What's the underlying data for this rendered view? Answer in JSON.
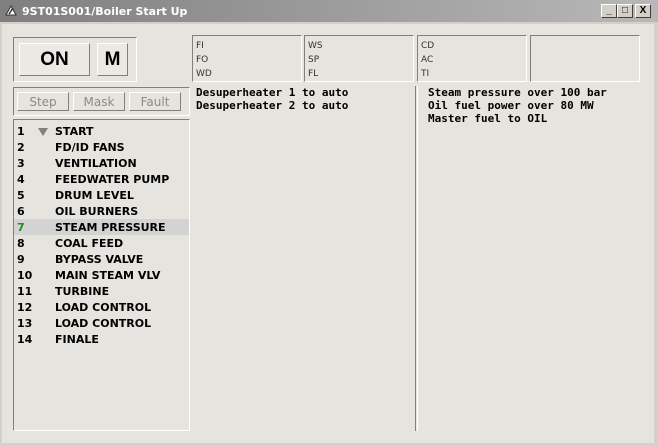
{
  "window": {
    "title": "9ST01S001/Boiler Start Up",
    "controls": {
      "minimize": "_",
      "maximize": "□",
      "close": "X"
    }
  },
  "mode": {
    "state": "ON",
    "mode_letter": "M"
  },
  "signals": [
    [
      "FI",
      "FO",
      "WD"
    ],
    [
      "WS",
      "SP",
      "FL"
    ],
    [
      "CD",
      "AC",
      "TI"
    ],
    []
  ],
  "buttons": {
    "step": "Step",
    "mask": "Mask",
    "fault": "Fault"
  },
  "steps": [
    {
      "num": "1",
      "name": "START",
      "marker": true,
      "active": false
    },
    {
      "num": "2",
      "name": "FD/ID FANS",
      "marker": false,
      "active": false
    },
    {
      "num": "3",
      "name": "VENTILATION",
      "marker": false,
      "active": false
    },
    {
      "num": "4",
      "name": "FEEDWATER PUMP",
      "marker": false,
      "active": false
    },
    {
      "num": "5",
      "name": "DRUM LEVEL",
      "marker": false,
      "active": false
    },
    {
      "num": "6",
      "name": "OIL BURNERS",
      "marker": false,
      "active": false
    },
    {
      "num": "7",
      "name": "STEAM PRESSURE",
      "marker": false,
      "active": true
    },
    {
      "num": "8",
      "name": "COAL FEED",
      "marker": false,
      "active": false
    },
    {
      "num": "9",
      "name": "BYPASS VALVE",
      "marker": false,
      "active": false
    },
    {
      "num": "10",
      "name": "MAIN STEAM VLV",
      "marker": false,
      "active": false
    },
    {
      "num": "11",
      "name": "TURBINE",
      "marker": false,
      "active": false
    },
    {
      "num": "12",
      "name": "LOAD CONTROL",
      "marker": false,
      "active": false
    },
    {
      "num": "13",
      "name": "LOAD CONTROL",
      "marker": false,
      "active": false
    },
    {
      "num": "14",
      "name": "FINALE",
      "marker": false,
      "active": false
    }
  ],
  "actions": [
    "Desuperheater 1 to auto",
    "Desuperheater 2 to auto"
  ],
  "conditions": [
    "Steam pressure over 100 bar",
    "Oil fuel power over 80 MW",
    "Master fuel to OIL"
  ]
}
